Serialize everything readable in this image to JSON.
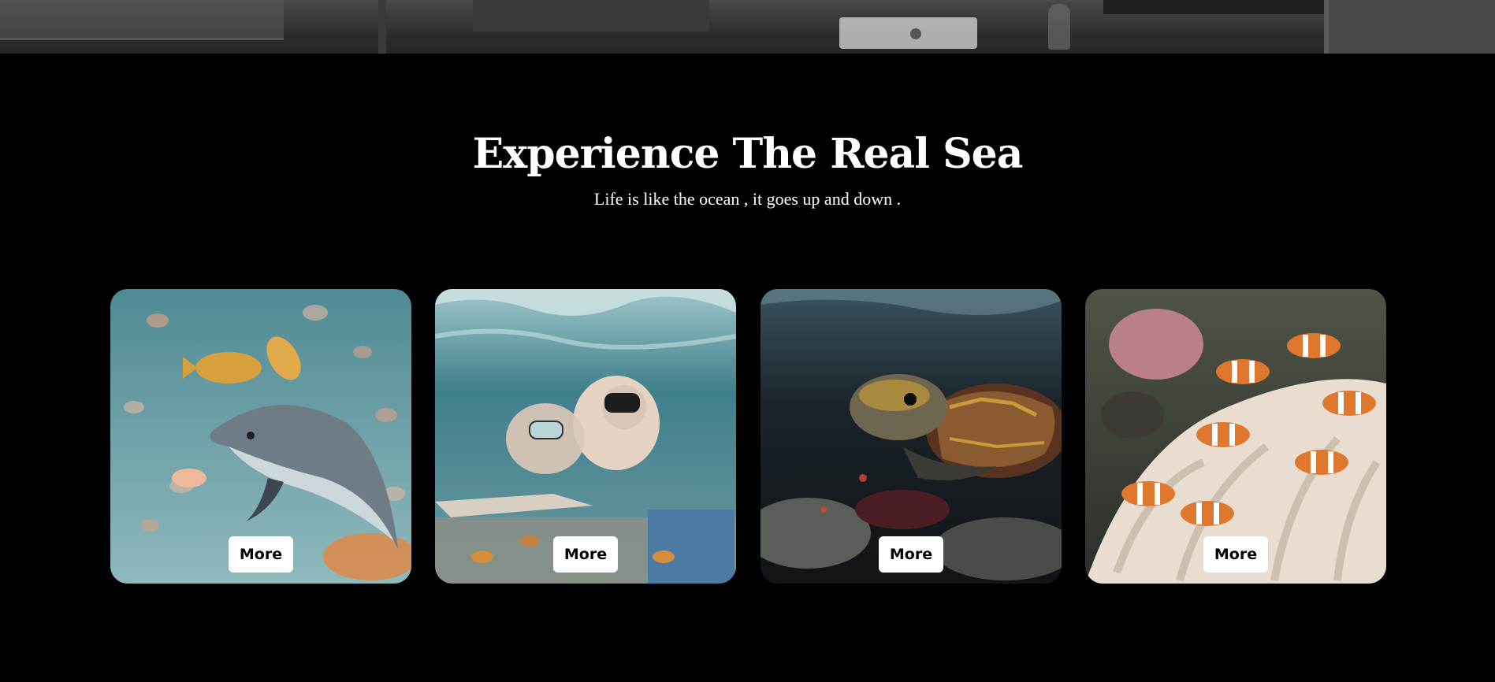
{
  "hero": {
    "image": "living-room-photo"
  },
  "section": {
    "title": "Experience The Real Sea",
    "subtitle": "Life is like the ocean , it goes up and down ."
  },
  "cards": [
    {
      "image": "dolphin-and-fish-photo",
      "button_label": "More"
    },
    {
      "image": "snorkelers-photo",
      "button_label": "More"
    },
    {
      "image": "sea-turtle-photo",
      "button_label": "More"
    },
    {
      "image": "clownfish-anemone-photo",
      "button_label": "More"
    }
  ],
  "colors": {
    "background": "#000000",
    "text": "#ffffff",
    "button": "#ffffff"
  }
}
